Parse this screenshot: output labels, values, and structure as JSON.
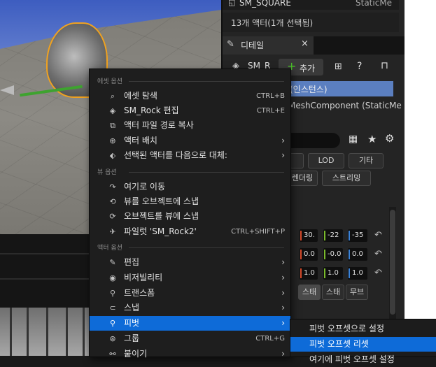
{
  "outliner": {
    "top_item": "SM_SQUARE",
    "top_item_type": "StaticMe"
  },
  "details_panel": {
    "actor_count": "13개 액터(1개 선택됨)",
    "tab_label": "디테일",
    "close_glyph": "×",
    "actor_name": "SM_R",
    "add_button": "추가",
    "component_row1": "(인스턴스)",
    "component_row2": "MeshComponent (StaticMe",
    "filter_pills_row1": [
      "LOD",
      "기타"
    ],
    "filter_pills_row2": [
      "렌더링",
      "스트리밍"
    ],
    "filter_pill_partial": "",
    "location": [
      "30.",
      "-22",
      "-35"
    ],
    "rotation": [
      "0.0",
      "-0.0",
      "0.0"
    ],
    "scale": [
      "1.0",
      "1.0",
      "1.0"
    ],
    "mobility": [
      "스태",
      "스태",
      "무브"
    ],
    "reset_glyph": "↶"
  },
  "context_menu": {
    "sections": [
      {
        "title": "에셋 옵션",
        "items": [
          {
            "label": "에셋 탐색",
            "shortcut": "CTRL+B",
            "icon": "browse-icon",
            "glyph": "⌕",
            "submenu": false
          },
          {
            "label": "SM_Rock 편집",
            "shortcut": "CTRL+E",
            "icon": "mesh-icon",
            "glyph": "◈",
            "submenu": false
          },
          {
            "label": "액터 파일 경로 복사",
            "shortcut": "",
            "icon": "copy-path-icon",
            "glyph": "⧉",
            "submenu": false
          },
          {
            "label": "액터 배치",
            "shortcut": "",
            "icon": "place-actor-icon",
            "glyph": "⊕",
            "submenu": true
          },
          {
            "label": "선택된 액터를 다음으로 대체:",
            "shortcut": "",
            "icon": "replace-icon",
            "glyph": "⬖",
            "submenu": true
          }
        ]
      },
      {
        "title": "뷰 옵션",
        "items": [
          {
            "label": "여기로 이동",
            "shortcut": "",
            "icon": "move-here-icon",
            "glyph": "↷",
            "submenu": false
          },
          {
            "label": "뷰를 오브젝트에 스냅",
            "shortcut": "",
            "icon": "snap-view-icon",
            "glyph": "⟲",
            "submenu": false
          },
          {
            "label": "오브젝트를 뷰에 스냅",
            "shortcut": "",
            "icon": "snap-object-icon",
            "glyph": "⟳",
            "submenu": false
          },
          {
            "label": "파일럿 'SM_Rock2'",
            "shortcut": "CTRL+SHIFT+P",
            "icon": "pilot-icon",
            "glyph": "✈",
            "submenu": false
          }
        ]
      },
      {
        "title": "액터 옵션",
        "items": [
          {
            "label": "편집",
            "shortcut": "",
            "icon": "edit-icon",
            "glyph": "✎",
            "submenu": true,
            "highlight": false
          },
          {
            "label": "비저빌리티",
            "shortcut": "",
            "icon": "visibility-icon",
            "glyph": "◉",
            "submenu": true,
            "highlight": false
          },
          {
            "label": "트랜스폼",
            "shortcut": "",
            "icon": "transform-icon",
            "glyph": "⚲",
            "submenu": true,
            "highlight": false
          },
          {
            "label": "스냅",
            "shortcut": "",
            "icon": "snap-icon",
            "glyph": "⊂",
            "submenu": true,
            "highlight": false
          },
          {
            "label": "피벗",
            "shortcut": "",
            "icon": "pivot-icon",
            "glyph": "⚲",
            "submenu": true,
            "highlight": true
          },
          {
            "label": "그룹",
            "shortcut": "CTRL+G",
            "icon": "group-icon",
            "glyph": "⊛",
            "submenu": false,
            "highlight": false
          },
          {
            "label": "붙이기",
            "shortcut": "",
            "icon": "attach-icon",
            "glyph": "⚯",
            "submenu": true,
            "highlight": false
          }
        ]
      }
    ],
    "arrow_glyph": "›"
  },
  "pivot_submenu": {
    "items": [
      {
        "label": "피벗 오프셋으로 설정",
        "highlight": false
      },
      {
        "label": "피벗 오프셋 리셋",
        "highlight": true
      },
      {
        "label": "여기에 피벗 오프셋 설정",
        "highlight": false
      }
    ]
  }
}
